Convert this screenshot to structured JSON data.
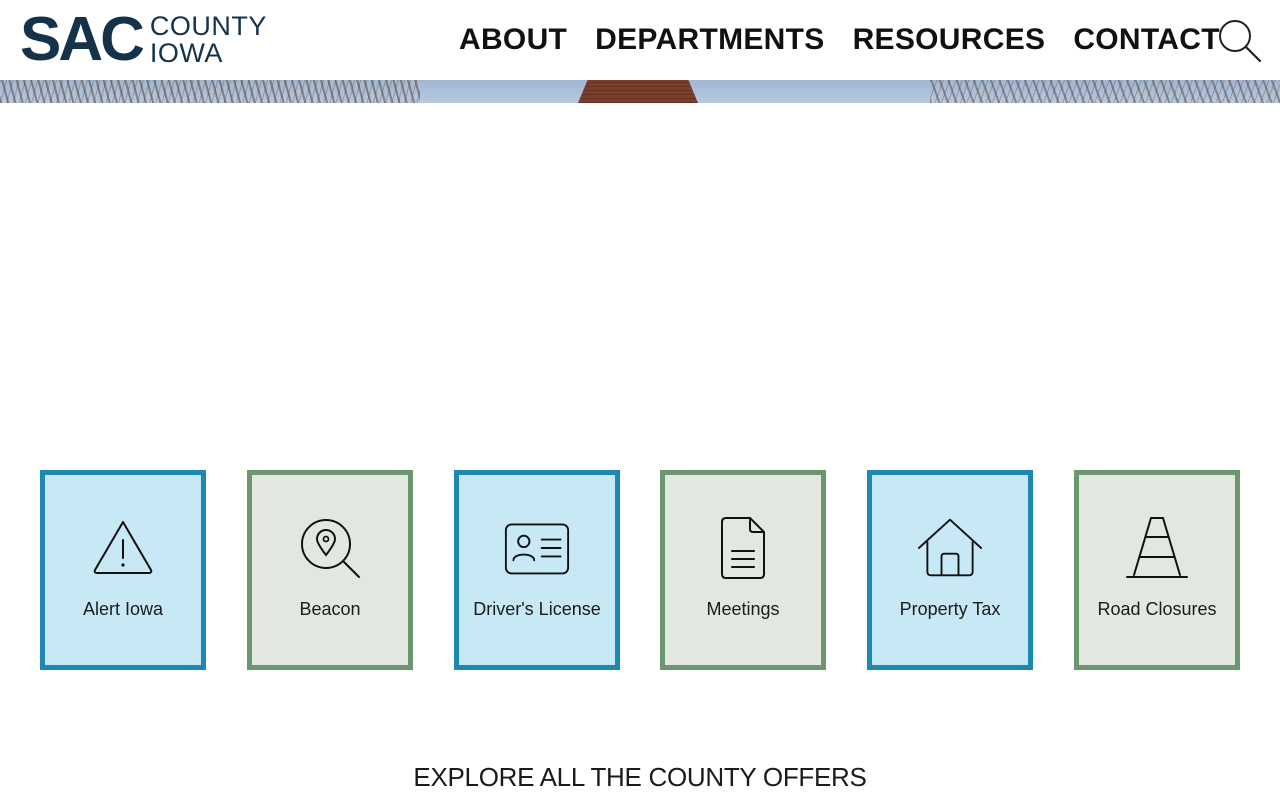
{
  "logo": {
    "primary": "SAC",
    "line1": "COUNTY",
    "line2": "IOWA"
  },
  "nav": {
    "items": [
      {
        "label": "ABOUT"
      },
      {
        "label": "DEPARTMENTS"
      },
      {
        "label": "RESOURCES"
      },
      {
        "label": "CONTACT"
      }
    ],
    "search_icon": "search-icon"
  },
  "colors": {
    "brand_navy": "#14324a",
    "tile_blue_bg": "#c7e8f5",
    "tile_blue_border": "#1e87b4",
    "tile_green_bg": "#e2e8e0",
    "tile_green_border": "#6c9670"
  },
  "quick_links": [
    {
      "label": "Alert Iowa",
      "icon": "warning-icon",
      "theme": "blue"
    },
    {
      "label": "Beacon",
      "icon": "map-search-icon",
      "theme": "green"
    },
    {
      "label": "Driver's License",
      "icon": "id-card-icon",
      "theme": "blue"
    },
    {
      "label": "Meetings",
      "icon": "document-icon",
      "theme": "green"
    },
    {
      "label": "Property Tax",
      "icon": "house-icon",
      "theme": "blue"
    },
    {
      "label": "Road Closures",
      "icon": "road-icon",
      "theme": "green"
    }
  ],
  "explore": {
    "heading": "EXPLORE ALL THE COUNTY OFFERS"
  }
}
